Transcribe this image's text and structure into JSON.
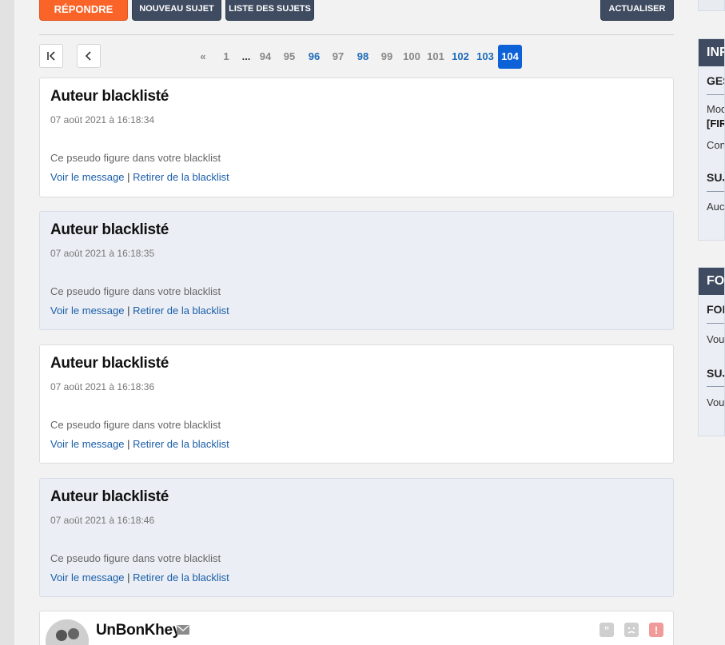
{
  "toolbar": {
    "reply_label": "RÉPONDRE",
    "new_topic_label": "NOUVEAU SUJET",
    "topic_list_label": "LISTE DES SUJETS",
    "refresh_label": "ACTUALISER"
  },
  "navigation": {
    "first_icon": "first-page-icon",
    "prev_icon": "chevron-left-icon"
  },
  "pagination": {
    "first": "«",
    "p1": "1",
    "ellipsis": "...",
    "p94": "94",
    "p95": "95",
    "p96": "96",
    "p97": "97",
    "p98": "98",
    "p99": "99",
    "p100": "100",
    "p101": "101",
    "p102": "102",
    "p103": "103",
    "current": "104"
  },
  "posts": [
    {
      "title": "Auteur blacklisté",
      "date": "07 août 2021 à 16:18:34",
      "message": "Ce pseudo figure dans votre blacklist",
      "view_link": "Voir le message",
      "separator": "|",
      "remove_link": "Retirer de la blacklist"
    },
    {
      "title": "Auteur blacklisté",
      "date": "07 août 2021 à 16:18:35",
      "message": "Ce pseudo figure dans votre blacklist",
      "view_link": "Voir le message",
      "separator": "|",
      "remove_link": "Retirer de la blacklist"
    },
    {
      "title": "Auteur blacklisté",
      "date": "07 août 2021 à 16:18:36",
      "message": "Ce pseudo figure dans votre blacklist",
      "view_link": "Voir le message",
      "separator": "|",
      "remove_link": "Retirer de la blacklist"
    },
    {
      "title": "Auteur blacklisté",
      "date": "07 août 2021 à 16:18:46",
      "message": "Ce pseudo figure dans votre blacklist",
      "view_link": "Voir le message",
      "separator": "|",
      "remove_link": "Retirer de la blacklist"
    }
  ],
  "last_post": {
    "username": "UnBonKhey",
    "icons": [
      "avatar-silhouette",
      "mail-icon",
      "quote-icon",
      "sad-icon",
      "alert-icon"
    ]
  },
  "sidebar": {
    "card1": {
      "header": "INF",
      "sub1": "GES",
      "line1": "Mod",
      "line2": "[FIR",
      "line3": "Con",
      "sub2": "SUJ",
      "line4": "Auc"
    },
    "card2": {
      "header": "FOR",
      "sub1": "FOR",
      "line1": "Vou",
      "sub2": "SUJ",
      "line2": "Vou"
    }
  },
  "colors": {
    "reply_button": "#fa6428",
    "dark_button": "#3f4b60",
    "current_page": "#0d62d8",
    "link": "#1b5ea8",
    "alt_post_bg": "#ebeff5"
  }
}
